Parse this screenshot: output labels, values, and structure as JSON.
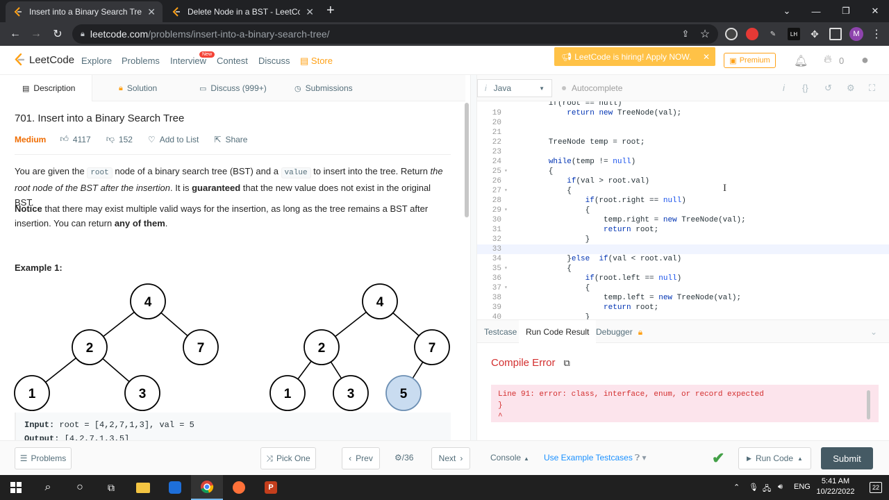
{
  "browser": {
    "tabs": [
      {
        "title": "Insert into a Binary Search Tree -",
        "close": "✕"
      },
      {
        "title": "Delete Node in a BST - LeetCode",
        "close": "✕"
      }
    ],
    "url_domain": "leetcode.com",
    "url_path": "/problems/insert-into-a-binary-search-tree/",
    "profile_initial": "M",
    "ext_label": "LH"
  },
  "nav": {
    "logo": "LeetCode",
    "links": [
      "Explore",
      "Problems",
      "Interview",
      "Contest",
      "Discuss",
      "Store"
    ],
    "new_badge": "New",
    "hiring": "LeetCode is hiring! Apply NOW.",
    "premium": "Premium",
    "points": "0"
  },
  "left_tabs": [
    "Description",
    "Solution",
    "Discuss (999+)",
    "Submissions"
  ],
  "problem": {
    "title": "701. Insert into a Binary Search Tree",
    "difficulty": "Medium",
    "likes": "4117",
    "dislikes": "152",
    "add_to_list": "Add to List",
    "share": "Share",
    "p1_a": "You are given the ",
    "p1_code1": "root",
    "p1_b": " node of a binary search tree (BST) and a ",
    "p1_code2": "value",
    "p1_c": " to insert into the tree. Return ",
    "p1_em": "the root node of the BST after the insertion",
    "p1_d": ". It is ",
    "p1_strong": "guaranteed",
    "p1_e": " that the new value does not exist in the original BST.",
    "p2_strong": "Notice",
    "p2_a": " that there may exist multiple valid ways for the insertion, as long as the tree remains a BST after insertion. You can return ",
    "p2_strong2": "any of them",
    "p2_b": ".",
    "example_title": "Example 1:",
    "tree_before": [
      "4",
      "2",
      "7",
      "1",
      "3"
    ],
    "tree_after": [
      "4",
      "2",
      "7",
      "1",
      "3",
      "5"
    ],
    "input_label": "Input:",
    "input_value": " root = [4,2,7,1,3], val = 5",
    "output_label": "Output:",
    "output_value": " [4,2,7,1,3,5]"
  },
  "editor": {
    "language": "Java",
    "autocomplete": "Autocomplete",
    "lines": [
      {
        "n": "19",
        "f": "",
        "code": "            return new TreeNode(val);"
      },
      {
        "n": "20",
        "f": "",
        "code": ""
      },
      {
        "n": "21",
        "f": "",
        "code": ""
      },
      {
        "n": "22",
        "f": "",
        "code": "        TreeNode temp = root;"
      },
      {
        "n": "23",
        "f": "",
        "code": ""
      },
      {
        "n": "24",
        "f": "",
        "code": "        while(temp != null)"
      },
      {
        "n": "25",
        "f": "▾",
        "code": "        {"
      },
      {
        "n": "26",
        "f": "",
        "code": "            if(val > root.val)"
      },
      {
        "n": "27",
        "f": "▾",
        "code": "            {"
      },
      {
        "n": "28",
        "f": "",
        "code": "                if(root.right == null)"
      },
      {
        "n": "29",
        "f": "▾",
        "code": "                {"
      },
      {
        "n": "30",
        "f": "",
        "code": "                    temp.right = new TreeNode(val);"
      },
      {
        "n": "31",
        "f": "",
        "code": "                    return root;"
      },
      {
        "n": "32",
        "f": "",
        "code": "                }"
      },
      {
        "n": "33",
        "f": "",
        "code": ""
      },
      {
        "n": "34",
        "f": "",
        "code": "            }else  if(val < root.val)"
      },
      {
        "n": "35",
        "f": "▾",
        "code": "            {"
      },
      {
        "n": "36",
        "f": "",
        "code": "                if(root.left == null)"
      },
      {
        "n": "37",
        "f": "▾",
        "code": "                {"
      },
      {
        "n": "38",
        "f": "",
        "code": "                    temp.left = new TreeNode(val);"
      },
      {
        "n": "39",
        "f": "",
        "code": "                    return root;"
      },
      {
        "n": "40",
        "f": "",
        "code": "                }"
      }
    ]
  },
  "result": {
    "tabs": [
      "Testcase",
      "Run Code Result",
      "Debugger"
    ],
    "heading": "Compile Error",
    "message": "Line 91: error: class, interface, enum, or record expected\n}\n^"
  },
  "bottom": {
    "problems": "Problems",
    "pick_one": "Pick One",
    "prev": "Prev",
    "page": "/36",
    "next": "Next",
    "console": "Console",
    "use_example": "Use Example Testcases",
    "run_code": "Run Code",
    "submit": "Submit"
  },
  "taskbar": {
    "lang": "ENG",
    "time": "5:41 AM",
    "date": "10/22/2022",
    "notifications": "22"
  }
}
